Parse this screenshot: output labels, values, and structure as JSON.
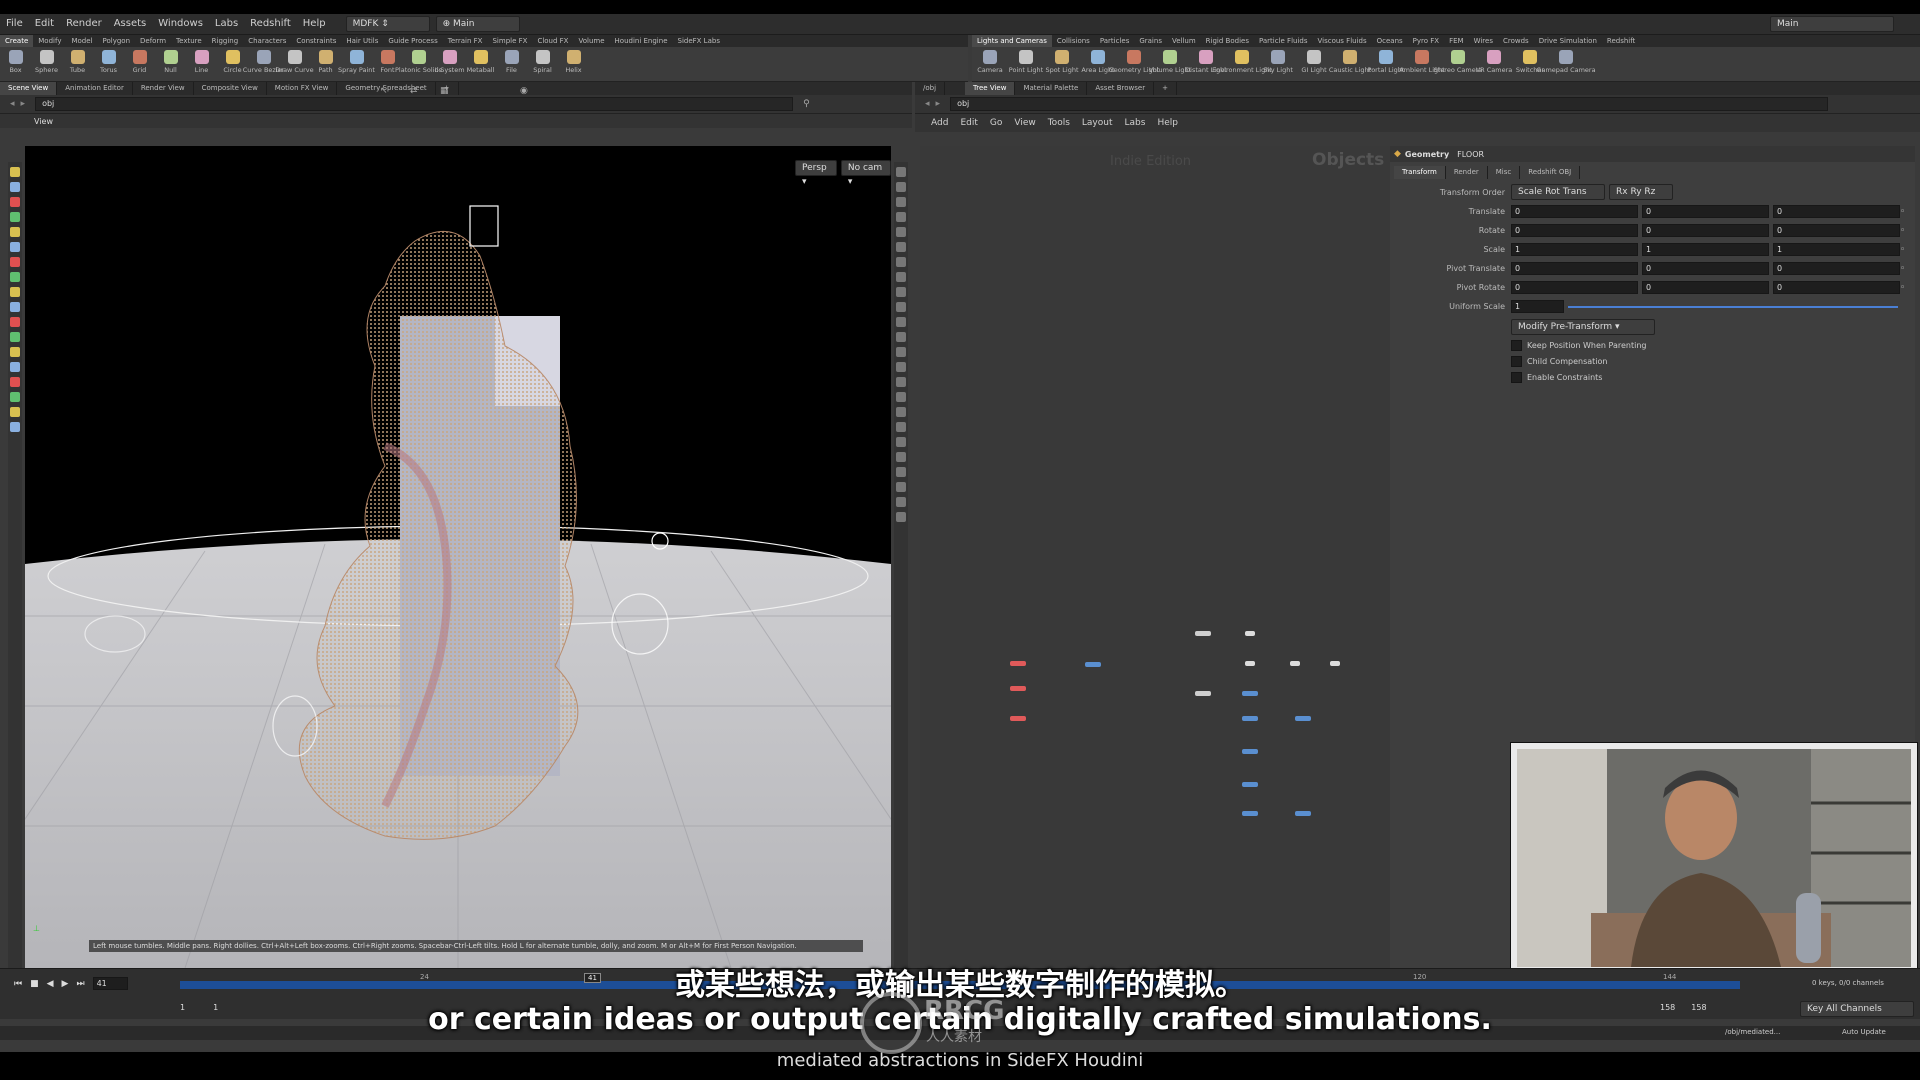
{
  "menubar": {
    "items": [
      "File",
      "Edit",
      "Render",
      "Assets",
      "Windows",
      "Labs",
      "Redshift",
      "Help"
    ],
    "desktop": "MDFK",
    "network": "Main",
    "right_desktop": "Main"
  },
  "shelf_left": {
    "tabs": [
      "Create",
      "Modify",
      "Model",
      "Polygon",
      "Deform",
      "Texture",
      "Rigging",
      "Characters",
      "Constraints",
      "Hair Utils",
      "Guide Process",
      "Terrain FX",
      "Simple FX",
      "Cloud FX",
      "Volume",
      "Houdini Engine",
      "SideFX Labs"
    ],
    "tools": [
      "Box",
      "Sphere",
      "Tube",
      "Torus",
      "Grid",
      "Null",
      "Line",
      "Circle",
      "Curve Bezier",
      "Draw Curve",
      "Path",
      "Spray Paint",
      "Font",
      "Platonic Solids",
      "L-System",
      "Metaball",
      "File",
      "Spiral",
      "Helix"
    ]
  },
  "shelf_right": {
    "tabs": [
      "Lights and Cameras",
      "Collisions",
      "Particles",
      "Grains",
      "Vellum",
      "Rigid Bodies",
      "Particle Fluids",
      "Viscous Fluids",
      "Oceans",
      "Pyro FX",
      "FEM",
      "Wires",
      "Crowds",
      "Drive Simulation",
      "Redshift"
    ],
    "tools": [
      "Camera",
      "Point Light",
      "Spot Light",
      "Area Light",
      "Geometry Light",
      "Volume Light",
      "Distant Light",
      "Environment Light",
      "Sky Light",
      "GI Light",
      "Caustic Light",
      "Portal Light",
      "Ambient Light",
      "Stereo Camera",
      "VR Camera",
      "Switcher",
      "Gamepad Camera"
    ]
  },
  "left_pane": {
    "tabs": [
      "Scene View",
      "Animation Editor",
      "Render View",
      "Composite View",
      "Motion FX View",
      "Geometry Spreadsheet"
    ],
    "path": "obj",
    "view_label": "View",
    "persp_btn": "Persp",
    "cam_btn": "No cam",
    "status_hint": "Left mouse tumbles. Middle pans. Right dollies. Ctrl+Alt+Left box-zooms. Ctrl+Right zooms. Spacebar-Ctrl-Left tilts. Hold L for alternate tumble, dolly, and zoom.    M or Alt+M for First Person Navigation."
  },
  "right_pane": {
    "tabs": [
      "/obj",
      "Tree View",
      "Material Palette",
      "Asset Browser"
    ],
    "path": "obj",
    "menu": [
      "Add",
      "Edit",
      "Go",
      "View",
      "Tools",
      "Layout",
      "Labs",
      "Help"
    ],
    "watermark_edition": "Indie Edition",
    "watermark_context": "Objects"
  },
  "params": {
    "type_label": "Geometry",
    "node_name": "FLOOR",
    "tabs": [
      "Transform",
      "Render",
      "Misc",
      "Redshift OBJ"
    ],
    "transform_order_label": "Transform Order",
    "transform_order_value": "Scale Rot Trans",
    "rot_order_value": "Rx Ry Rz",
    "rows": [
      {
        "label": "Translate",
        "values": [
          "0",
          "0",
          "0"
        ]
      },
      {
        "label": "Rotate",
        "values": [
          "0",
          "0",
          "0"
        ]
      },
      {
        "label": "Scale",
        "values": [
          "1",
          "1",
          "1"
        ]
      },
      {
        "label": "Pivot Translate",
        "values": [
          "0",
          "0",
          "0"
        ]
      },
      {
        "label": "Pivot Rotate",
        "values": [
          "0",
          "0",
          "0"
        ]
      }
    ],
    "uniform_scale_label": "Uniform Scale",
    "uniform_scale_value": "1",
    "modify_pretransform": "Modify Pre-Transform",
    "checkboxes": [
      "Keep Position When Parenting",
      "Child Compensation",
      "Enable Constraints"
    ]
  },
  "timeline": {
    "current_frame": "41",
    "start": "1",
    "start2": "1",
    "end": "158",
    "end2": "158",
    "ticks": [
      "24",
      "120",
      "144"
    ],
    "marker": "41",
    "keys_info": "0 keys, 0/0 channels",
    "key_all": "Key All Channels",
    "auto_update": "Auto Update",
    "status_path": "/obj/mediated..."
  },
  "subtitles": {
    "chinese": "或某些想法，或输出某些数字制作的模拟。",
    "english": "or certain ideas or output certain digitally crafted simulations.",
    "footer": "mediated abstractions in SideFX Houdini"
  },
  "watermark": {
    "brand": "RRCG",
    "sub": "人人素材"
  }
}
